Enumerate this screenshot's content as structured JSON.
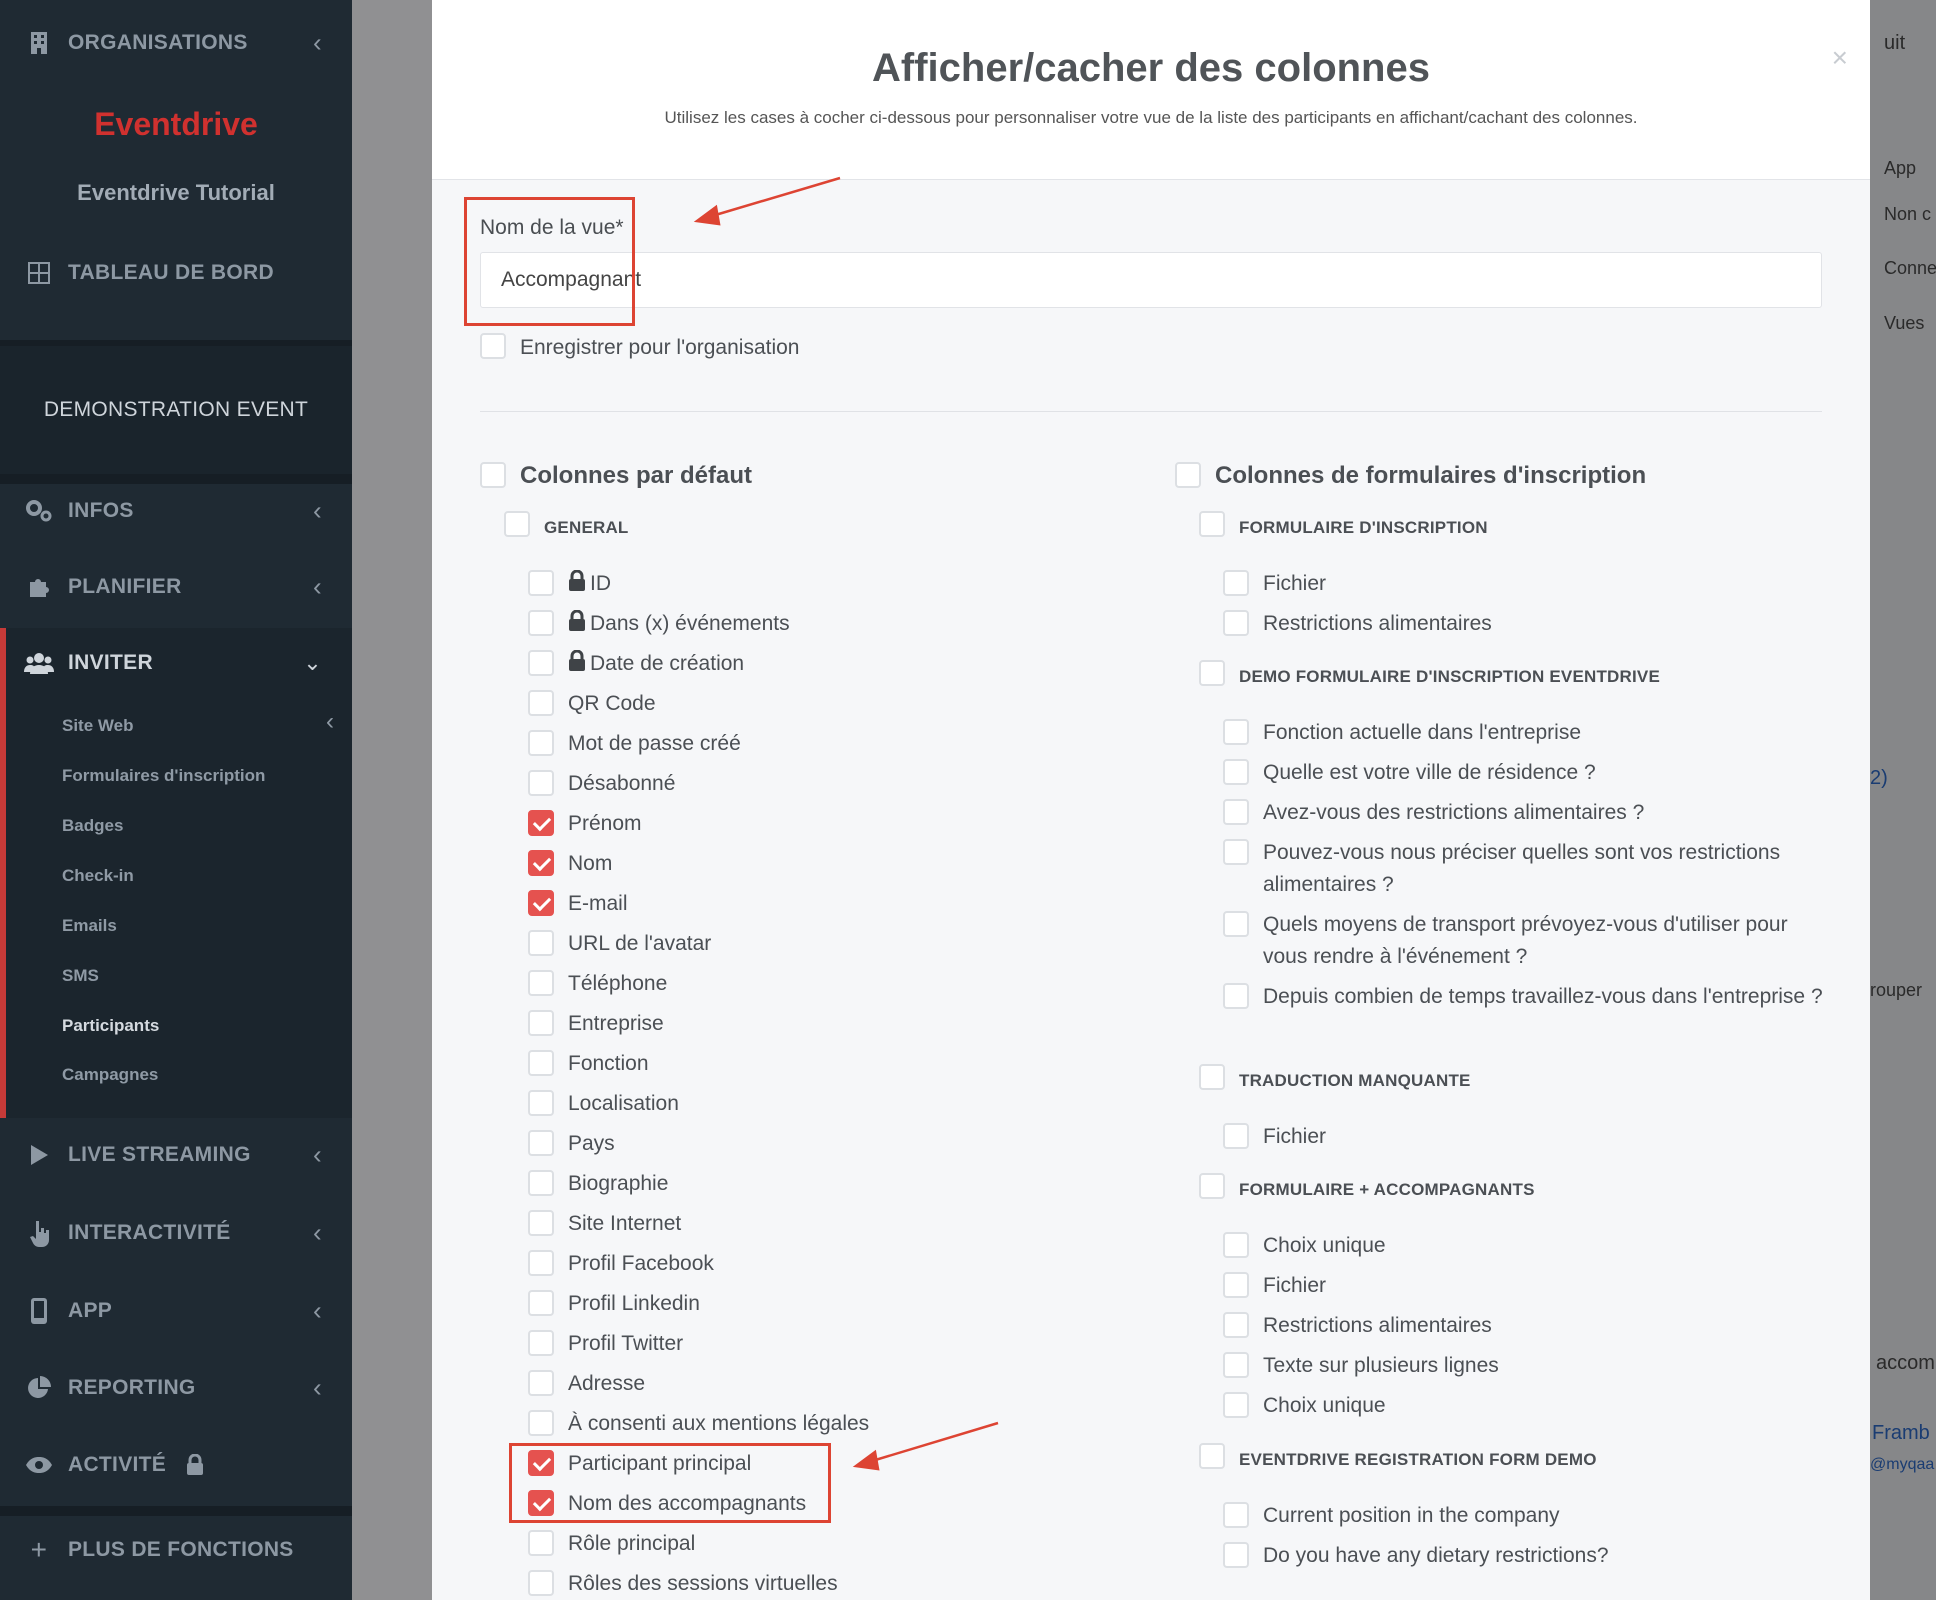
{
  "sidebar": {
    "organisations": "ORGANISATIONS",
    "brand": "Eventdrive",
    "tutorial": "Eventdrive Tutorial",
    "dashboard": "TABLEAU DE BORD",
    "event": "DEMONSTRATION EVENT",
    "infos": "INFOS",
    "planifier": "PLANIFIER",
    "inviter": "INVITER",
    "sub": [
      "Site Web",
      "Formulaires d'inscription",
      "Badges",
      "Check-in",
      "Emails",
      "SMS",
      "Participants",
      "Campagnes"
    ],
    "live": "LIVE STREAMING",
    "interactivite": "INTERACTIVITÉ",
    "app": "APP",
    "reporting": "REPORTING",
    "activite": "ACTIVITÉ",
    "plus": "PLUS DE FONCTIONS",
    "active_color": "#c63a38"
  },
  "background": {
    "top_right": "uit",
    "app": "App",
    "non": "Non c",
    "conne": "Conne",
    "vues": "Vues",
    "count": "2)",
    "grouper": "rouper",
    "accom": "accom",
    "framb": "Framb",
    "email": "@myqaa"
  },
  "modal": {
    "title": "Afficher/cacher des colonnes",
    "subtitle": "Utilisez les cases à cocher ci-dessous pour personnaliser votre vue de la liste des participants en affichant/cachant des colonnes.",
    "close": "×",
    "view_name_label": "Nom de la vue*",
    "view_name_value": "Accompagnant",
    "save_org": "Enregistrer pour l'organisation",
    "default_cols": "Colonnes par défaut",
    "general": "GENERAL",
    "general_items": [
      {
        "label": "ID",
        "checked": false,
        "locked": true
      },
      {
        "label": "Dans (x) événements",
        "checked": false,
        "locked": true
      },
      {
        "label": "Date de création",
        "checked": false,
        "locked": true
      },
      {
        "label": "QR Code",
        "checked": false
      },
      {
        "label": "Mot de passe créé",
        "checked": false
      },
      {
        "label": "Désabonné",
        "checked": false
      },
      {
        "label": "Prénom",
        "checked": true
      },
      {
        "label": "Nom",
        "checked": true
      },
      {
        "label": "E-mail",
        "checked": true
      },
      {
        "label": "URL de l'avatar",
        "checked": false
      },
      {
        "label": "Téléphone",
        "checked": false
      },
      {
        "label": "Entreprise",
        "checked": false
      },
      {
        "label": "Fonction",
        "checked": false
      },
      {
        "label": "Localisation",
        "checked": false
      },
      {
        "label": "Pays",
        "checked": false
      },
      {
        "label": "Biographie",
        "checked": false
      },
      {
        "label": "Site Internet",
        "checked": false
      },
      {
        "label": "Profil Facebook",
        "checked": false
      },
      {
        "label": "Profil Linkedin",
        "checked": false
      },
      {
        "label": "Profil Twitter",
        "checked": false
      },
      {
        "label": "Adresse",
        "checked": false
      },
      {
        "label": "À consenti aux mentions légales",
        "checked": false
      },
      {
        "label": "Participant principal",
        "checked": true
      },
      {
        "label": "Nom des accompagnants",
        "checked": true
      },
      {
        "label": "Rôle principal",
        "checked": false
      },
      {
        "label": "Rôles des sessions virtuelles",
        "checked": false
      }
    ],
    "form_cols": "Colonnes de formulaires d'inscription",
    "form1": "FORMULAIRE D'INSCRIPTION",
    "form1_items": [
      "Fichier",
      "Restrictions alimentaires"
    ],
    "form2": "DEMO FORMULAIRE D'INSCRIPTION EVENTDRIVE",
    "form2_items": [
      "Fonction actuelle dans l'entreprise",
      "Quelle est votre ville de résidence ?",
      "Avez-vous des restrictions alimentaires ?",
      "Pouvez-vous nous préciser quelles sont vos restrictions alimentaires ?",
      "Quels moyens de transport prévoyez-vous d'utiliser pour vous rendre à l'événement ?",
      "Depuis combien de temps travaillez-vous dans l'entreprise ?"
    ],
    "form3": "TRADUCTION MANQUANTE",
    "form3_items": [
      "Fichier"
    ],
    "form4": "FORMULAIRE + ACCOMPAGNANTS",
    "form4_items": [
      "Choix unique",
      "Fichier",
      "Restrictions alimentaires",
      "Texte sur plusieurs lignes",
      "Choix unique"
    ],
    "form5": "EVENTDRIVE REGISTRATION FORM DEMO",
    "form5_items": [
      "Current position in the company",
      "Do you have any dietary restrictions?"
    ],
    "check_color": "#e5524f",
    "highlight_color": "#dd4433"
  }
}
